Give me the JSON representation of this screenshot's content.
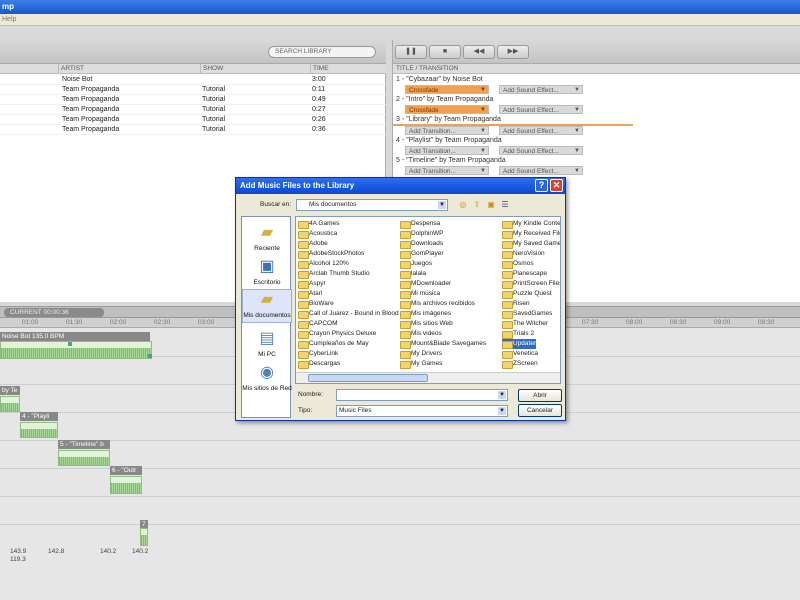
{
  "window": {
    "title": "mp",
    "menu": "Help"
  },
  "library": {
    "search_placeholder": "SEARCH LIBRARY",
    "columns": [
      "ARTIST",
      "SHOW",
      "TIME"
    ],
    "rows": [
      {
        "artist": "Noise Bot",
        "show": "",
        "time": "3:00"
      },
      {
        "artist": "Team Propaganda",
        "show": "Tutorial",
        "time": "0:11"
      },
      {
        "artist": "Team Propaganda",
        "show": "Tutorial",
        "time": "0:49"
      },
      {
        "artist": "Team Propaganda",
        "show": "Tutorial",
        "time": "0:27"
      },
      {
        "artist": "Team Propaganda",
        "show": "Tutorial",
        "time": "0:26"
      },
      {
        "artist": "Team Propaganda",
        "show": "Tutorial",
        "time": "0:36"
      }
    ]
  },
  "playlist": {
    "header": "TITLE / TRANSITION",
    "entries": [
      {
        "title": "1 - \"Cybazaar\" by Noise Bot",
        "transition": "Crossfade",
        "sound": "Add Sound Effect..."
      },
      {
        "title": "2 - \"Intro\" by Team Propaganda",
        "transition": "Crossfade",
        "sound": "Add Sound Effect..."
      },
      {
        "title": "3 - \"Library\" by Team Propaganda",
        "transition": "Add Transition...",
        "sound": "Add Sound Effect..."
      },
      {
        "title": "4 - \"Playlist\" by Team Propaganda",
        "transition": "Add Transition...",
        "sound": "Add Sound Effect..."
      },
      {
        "title": "5 - \"Timeline\" by Team Propaganda",
        "transition": "Add Transition...",
        "sound": "Add Sound Effect..."
      }
    ]
  },
  "timeline": {
    "current": "CURRENT 00:00:36",
    "ticks": [
      "01:00",
      "01:30",
      "02:00",
      "02:30",
      "03:00",
      "07:30",
      "08:00",
      "08:30",
      "09:00",
      "09:30"
    ],
    "clip1": "Noise Bot 135.0 BPM",
    "clip2": "by Te",
    "clip3": "4 - \"Playli",
    "clip4": "5 - \"Timeline\" b",
    "clip5": "6 - \"Outr",
    "clip6": "7",
    "bpm": [
      "143.9",
      "119.3",
      "142.8",
      "140.2",
      "140.2"
    ]
  },
  "dialog": {
    "title": "Add Music Files to the Library",
    "look_in_label": "Buscar en:",
    "look_in_value": "Mis documentos",
    "places": [
      "Reciente",
      "Escritorio",
      "Mis documentos",
      "Mi PC",
      "Mis sitios de Red"
    ],
    "files_col1": [
      "4A Games",
      "Acoustica",
      "Adobe",
      "AdobeStockPhotos",
      "Alcohol 120%",
      "Arclab Thumb Studio",
      "Aspyr",
      "Atari",
      "BioWare",
      "Call of Juarez - Bound in Blood",
      "CAPCOM",
      "Crayon Physics Deluxe",
      "Cumpleaños de May",
      "CyberLink",
      "Descargas"
    ],
    "files_col2": [
      "Despensa",
      "DolphinWP",
      "Downloads",
      "GomPlayer",
      "Juegos",
      "lalala",
      "MDownloader",
      "Mi música",
      "Mis archivos recibidos",
      "Mis imágenes",
      "Mis sitios Web",
      "Mis videos",
      "Mount&Blade Savegames",
      "My Drivers",
      "My Games"
    ],
    "files_col3": [
      "My Kindle Conten",
      "My Received Files",
      "My Saved Games",
      "NeroVision",
      "Osmos",
      "Planescape",
      "PrintScreen Files",
      "Puzzle Quest",
      "Risen",
      "SavedGames",
      "The Witcher",
      "Trials 2",
      "Updater",
      "Venetica",
      "ZScreen"
    ],
    "name_label": "Nombre:",
    "type_label": "Tipo:",
    "type_value": "Music Files",
    "open_label": "Abrir",
    "cancel_label": "Cancelar"
  }
}
